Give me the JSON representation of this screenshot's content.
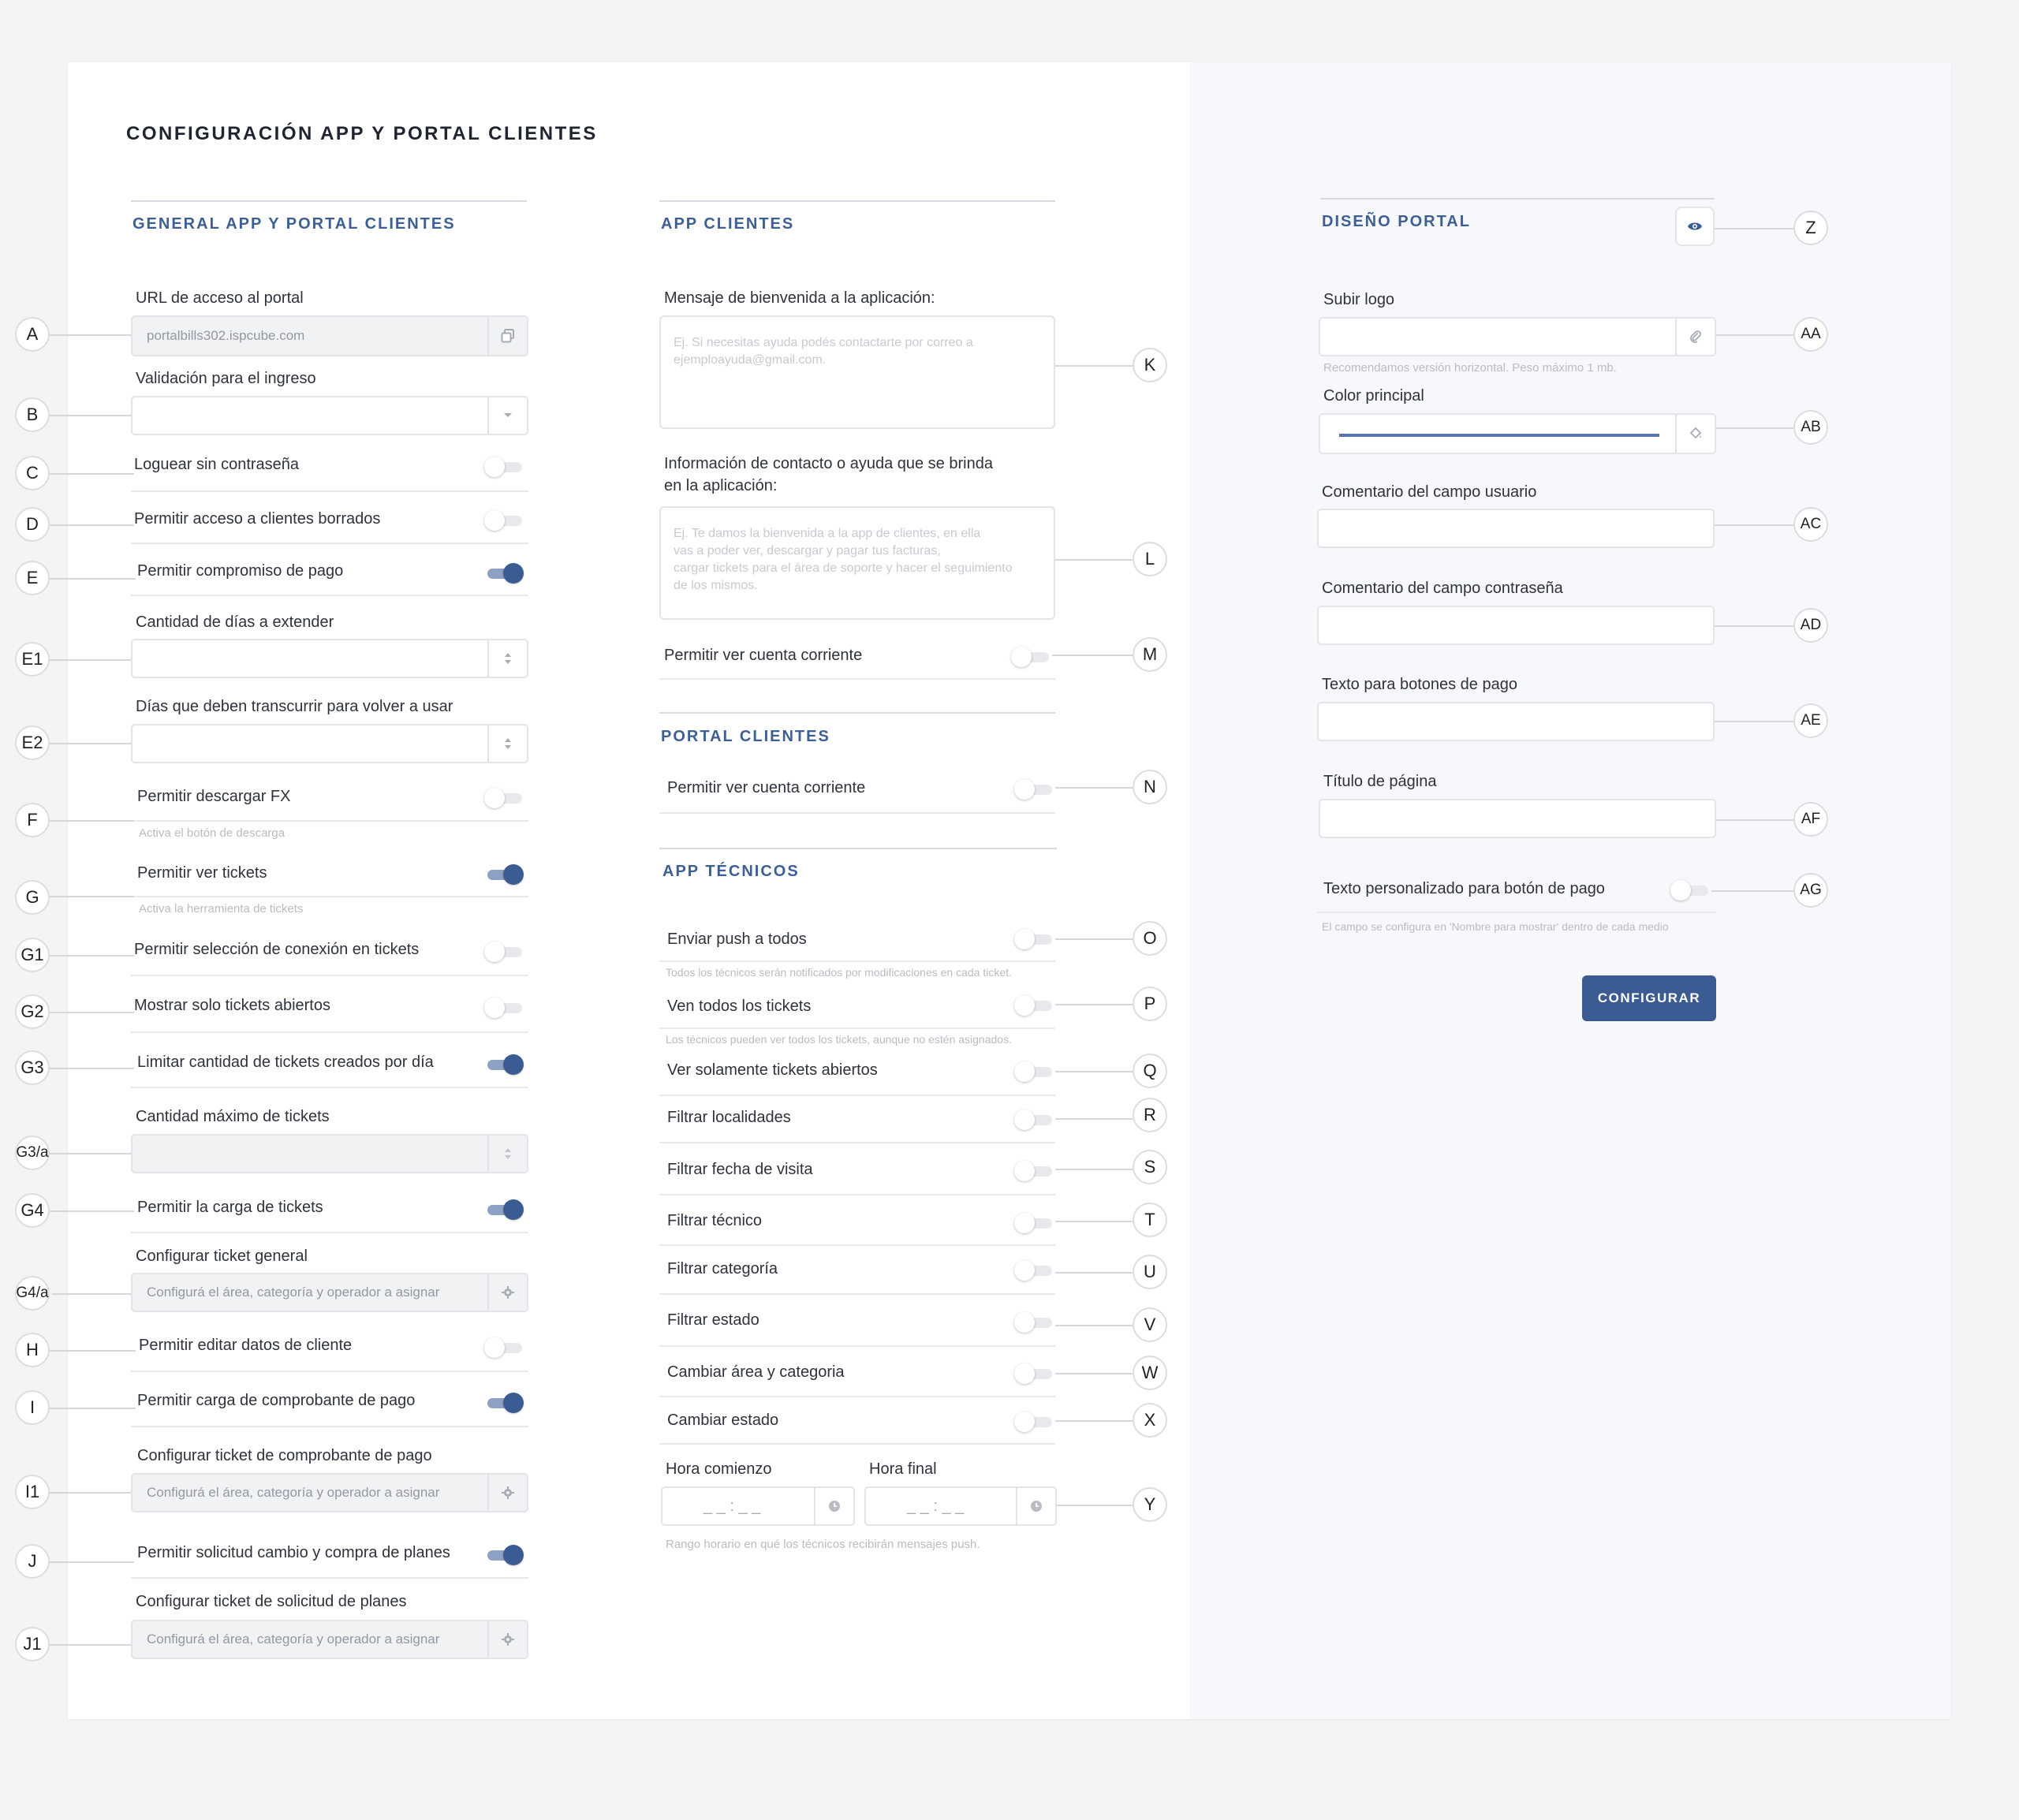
{
  "page_title": "CONFIGURACIÓN APP Y PORTAL CLIENTES",
  "sections": {
    "general": "GENERAL APP Y PORTAL CLIENTES",
    "app_clientes": "APP CLIENTES",
    "portal_clientes": "PORTAL CLIENTES",
    "app_tecnicos": "APP TÉCNICOS",
    "diseno_portal": "DISEÑO PORTAL"
  },
  "general": {
    "url_label": "URL de acceso al portal",
    "url_value": "portalbills302.ispcube.com",
    "validacion_label": "Validación para el ingreso",
    "validacion_value": "",
    "loguear_label": "Loguear sin contraseña",
    "loguear_on": false,
    "borrados_label": "Permitir acceso a clientes borrados",
    "borrados_on": false,
    "compromiso_label": "Permitir compromiso de pago",
    "compromiso_on": true,
    "dias_extender_label": "Cantidad de días a extender",
    "dias_extender_value": "",
    "dias_transcurrir_label": "Días que deben transcurrir para volver a usar",
    "dias_transcurrir_value": "",
    "descargar_label": "Permitir descargar FX",
    "descargar_on": false,
    "descargar_hint": "Activa el botón de descarga",
    "ver_tickets_label": "Permitir ver tickets",
    "ver_tickets_on": true,
    "ver_tickets_hint": "Activa la herramienta de tickets",
    "seleccion_conexion_label": "Permitir selección de conexión en tickets",
    "seleccion_conexion_on": false,
    "solo_abiertos_label": "Mostrar solo tickets abiertos",
    "solo_abiertos_on": false,
    "limitar_label": "Limitar cantidad de tickets creados por día",
    "limitar_on": true,
    "cantidad_max_label": "Cantidad máximo de tickets",
    "cantidad_max_value": "",
    "carga_tickets_label": "Permitir la carga de tickets",
    "carga_tickets_on": true,
    "ticket_general_label": "Configurar ticket general",
    "ticket_general_value": "Configurá el área, categoría y operador a asignar",
    "editar_datos_label": "Permitir editar datos de cliente",
    "editar_datos_on": false,
    "comprobante_label": "Permitir carga de comprobante de pago",
    "comprobante_on": true,
    "ticket_comprobante_label": "Configurar ticket de comprobante de pago",
    "ticket_comprobante_value": "Configurá el área, categoría y operador a asignar",
    "cambio_planes_label": "Permitir solicitud cambio y compra de planes",
    "cambio_planes_on": true,
    "ticket_planes_label": "Configurar ticket de solicitud de planes",
    "ticket_planes_value": "Configurá el área, categoría y operador a asignar"
  },
  "app_clientes": {
    "bienvenida_label": "Mensaje de bienvenida a la aplicación:",
    "bienvenida_placeholder": "Ej. Si necesitas ayuda podés contactarte por correo a\nejemploayuda@gmail.com.",
    "contacto_label_1": "Información de contacto o ayuda que se brinda",
    "contacto_label_2": "en la aplicación:",
    "contacto_placeholder": "Ej. Te damos la bienvenida a la app de clientes, en ella\nvas a poder ver, descargar y pagar tus facturas,\ncargar tickets para el área de soporte y hacer el seguimiento\nde los mismos.",
    "cuenta_corriente_label": "Permitir ver cuenta corriente",
    "cuenta_corriente_on": false
  },
  "portal_clientes": {
    "cuenta_corriente_label": "Permitir ver cuenta corriente",
    "cuenta_corriente_on": false
  },
  "app_tecnicos": {
    "push_label": "Enviar push a todos",
    "push_hint": "Todos los técnicos serán notificados por modificaciones en cada ticket.",
    "todos_tickets_label": "Ven todos los tickets",
    "todos_tickets_hint": "Los técnicos pueden ver todos los tickets, aunque no estén asignados.",
    "solo_abiertos_label": "Ver solamente tickets abiertos",
    "localidades_label": "Filtrar localidades",
    "fecha_visita_label": "Filtrar fecha de visita",
    "tecnico_label": "Filtrar técnico",
    "categoria_label": "Filtrar categoría",
    "estado_label": "Filtrar estado",
    "area_categoria_label": "Cambiar área y categoria",
    "cambiar_estado_label": "Cambiar estado",
    "hora_comienzo_label": "Hora comienzo",
    "hora_final_label": "Hora final",
    "hora_placeholder": "_ _ : _ _",
    "rango_hint": "Rango horario en qué los técnicos recibirán mensajes push."
  },
  "diseno_portal": {
    "logo_label": "Subir logo",
    "logo_hint": "Recomendamos versión horizontal. Peso máximo 1 mb.",
    "color_label": "Color principal",
    "color_value": "#5675b0",
    "usuario_label": "Comentario del campo usuario",
    "contrasena_label": "Comentario del campo contraseña",
    "botones_pago_label": "Texto para botones de pago",
    "titulo_label": "Título de página",
    "personalizado_label": "Texto personalizado para botón de pago",
    "personalizado_on": false,
    "personalizado_hint": "El campo se configura en 'Nombre para mostrar' dentro de cada medio",
    "configurar_button": "CONFIGURAR"
  },
  "markers": {
    "A": "A",
    "B": "B",
    "C": "C",
    "D": "D",
    "E": "E",
    "E1": "E1",
    "E2": "E2",
    "F": "F",
    "G": "G",
    "G1": "G1",
    "G2": "G2",
    "G3": "G3",
    "G3a": "G3/a",
    "G4": "G4",
    "G4a": "G4/a",
    "H": "H",
    "I": "I",
    "I1": "I1",
    "J": "J",
    "J1": "J1",
    "K": "K",
    "L": "L",
    "M": "M",
    "N": "N",
    "O": "O",
    "P": "P",
    "Q": "Q",
    "R": "R",
    "S": "S",
    "T": "T",
    "U": "U",
    "V": "V",
    "W": "W",
    "X": "X",
    "Y": "Y",
    "Z": "Z",
    "AA": "AA",
    "AB": "AB",
    "AC": "AC",
    "AD": "AD",
    "AE": "AE",
    "AF": "AF",
    "AG": "AG"
  },
  "colors": {
    "accent": "#3b5c93",
    "toggle_on_track": "#8ea0c3",
    "panel_bg": "#f7f8fb"
  }
}
